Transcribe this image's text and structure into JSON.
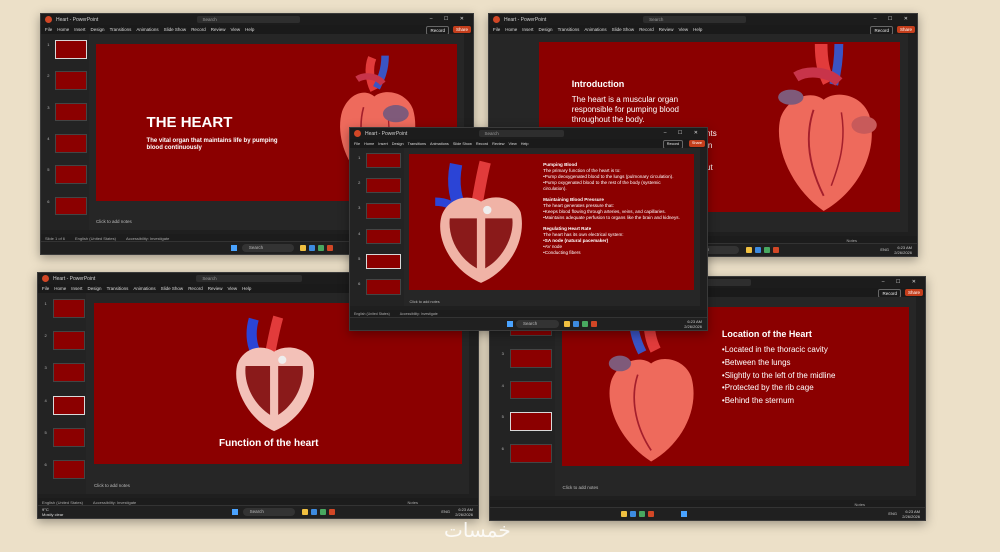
{
  "window": {
    "app_title": "Heart - PowerPoint",
    "search_placeholder": "Search",
    "window_controls": "– ☐ ✕",
    "ribbon_tabs": [
      "File",
      "Home",
      "Insert",
      "Design",
      "Transitions",
      "Animations",
      "Slide Show",
      "Record",
      "Review",
      "View",
      "Help"
    ],
    "record_label": "Record",
    "share_label": "Share"
  },
  "status": {
    "slide_indicator": "Slide 1 of 6",
    "language": "English (United States)",
    "accessibility": "Accessibility: Investigate",
    "notes_label": "Notes",
    "notes_placeholder": "Click to add notes"
  },
  "taskbar": {
    "search_label": "Search",
    "weather_temp": "9°C",
    "weather_desc": "Mostly clear",
    "language": "ENG",
    "time": "6:23 AM",
    "date": "2/26/2026"
  },
  "slides": {
    "title_slide": {
      "title": "THE HEART",
      "subtitle": "The vital organ that maintains life by pumping blood continuously"
    },
    "intro_slide": {
      "heading": "Introduction",
      "body": "The heart is a muscular organ responsible for pumping blood throughout the body.",
      "overflow_1": "ents",
      "overflow_2": "ion",
      "overflow_3": "out"
    },
    "function_slide": {
      "title": "Function of the heart"
    },
    "location_slide": {
      "heading": "Location of the Heart",
      "items": [
        "•Located in the thoracic cavity",
        "•Between the lungs",
        "•Slightly to the left of the midline",
        "•Protected by the rib cage",
        "•Behind the sternum"
      ]
    },
    "detail_slide": {
      "pumping_heading": "Pumping Blood",
      "pumping_intro": "The primary function of the heart is to:",
      "pumping_1": "•Pump deoxygenated blood to the lungs (pulmonary circulation).",
      "pumping_2": "•Pump oxygenated blood to the rest of the body (systemic circulation).",
      "pressure_heading": "Maintaining Blood Pressure",
      "pressure_intro": "The heart generates pressure that:",
      "pressure_1": "•Keeps blood flowing through arteries, veins, and capillaries.",
      "pressure_2": "•Maintains adequate perfusion to organs like the brain and kidneys.",
      "rate_heading": "Regulating Heart Rate",
      "rate_intro": "The heart has its own electrical system:",
      "rate_1": "•SA node (natural pacemaker)",
      "rate_2": "•AV node",
      "rate_3": "•Conducting fibers"
    }
  },
  "watermark": "خمسات",
  "colors": {
    "background": "#ece0c8",
    "slide_red": "#8b0000",
    "accent": "#c43e1c"
  }
}
